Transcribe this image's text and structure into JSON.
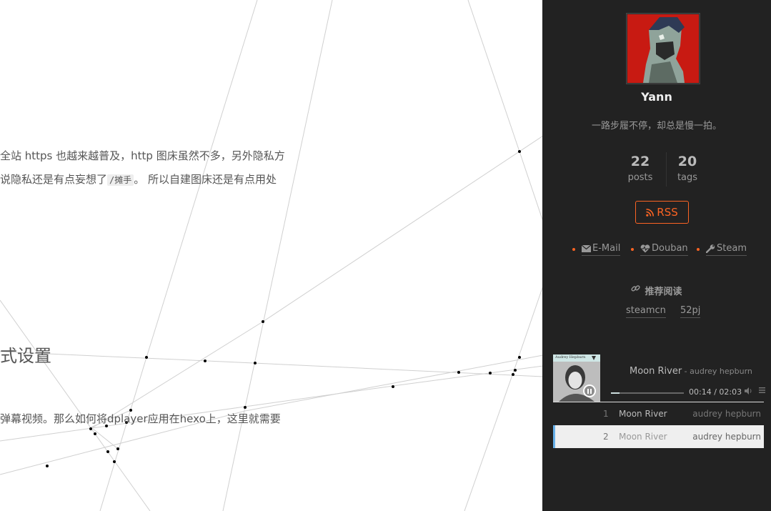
{
  "article": {
    "paragraph1": {
      "line1": "全站 https 也越来越普及，http 图床虽然不多，另外隐私方",
      "line2_before": "说隐私还是有点妄想了",
      "line2_code": "/摊手",
      "line2_after": "。 所以自建图床还是有点用处"
    },
    "heading": "式设置",
    "paragraph2": "弹幕视频。那么如何将dplayer应用在hexo上，这里就需要"
  },
  "sidebar": {
    "author": "Yann",
    "motto": "一路步履不停，却总是慢一拍。",
    "stats": {
      "posts_count": "22",
      "posts_label": "posts",
      "tags_count": "20",
      "tags_label": "tags"
    },
    "rss_label": "RSS",
    "social": [
      {
        "label": "E-Mail",
        "icon": "envelope-icon"
      },
      {
        "label": "Douban",
        "icon": "heartbeat-icon"
      },
      {
        "label": "Steam",
        "icon": "wrench-icon"
      }
    ],
    "recommend": {
      "title": "推荐阅读",
      "links": [
        "steamcn",
        "52pj"
      ]
    }
  },
  "player": {
    "cover_caption": "Audrey Hepburn",
    "title": "Moon River",
    "artist_separator": " - ",
    "artist": "audrey hepburn",
    "current_time": "00:14",
    "time_separator": " / ",
    "duration": "02:03",
    "progress": 0.114,
    "playlist": [
      {
        "index": "1",
        "title": "Moon River",
        "artist": "audrey hepburn"
      },
      {
        "index": "2",
        "title": "Moon River",
        "artist": "audrey hepburn"
      }
    ]
  },
  "colors": {
    "sidebar_bg": "#222222",
    "accent": "#fc6423",
    "playlist_active_border": "#66afe9"
  }
}
